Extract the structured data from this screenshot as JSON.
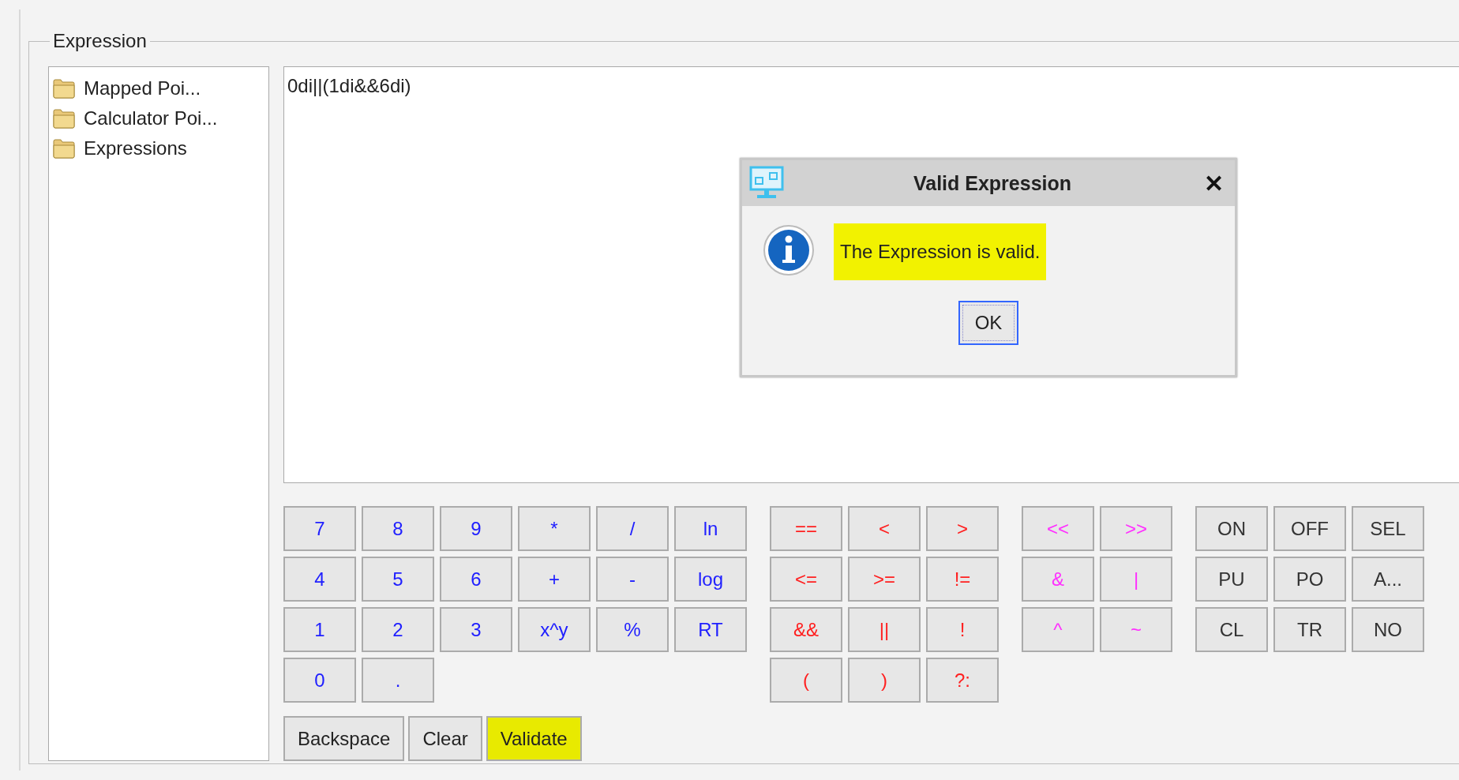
{
  "group": {
    "title": "Expression"
  },
  "tree": {
    "items": [
      {
        "label": "Mapped Poi..."
      },
      {
        "label": "Calculator Poi..."
      },
      {
        "label": "Expressions"
      }
    ]
  },
  "editor": {
    "value": "0di||(1di&&6di)"
  },
  "keypad": {
    "groups": [
      {
        "kind": "number",
        "rows": [
          [
            "7",
            "8",
            "9",
            "*",
            "/",
            "ln"
          ],
          [
            "4",
            "5",
            "6",
            "+",
            "-",
            "log"
          ],
          [
            "1",
            "2",
            "3",
            "x^y",
            "%",
            "RT"
          ],
          [
            "0",
            "."
          ]
        ]
      },
      {
        "kind": "logic",
        "rows": [
          [
            "==",
            "<",
            ">"
          ],
          [
            "<=",
            ">=",
            "!="
          ],
          [
            "&&",
            "||",
            "!"
          ],
          [
            "(",
            ")",
            "?:"
          ]
        ]
      },
      {
        "kind": "bitwise",
        "rows": [
          [
            "<<",
            ">>"
          ],
          [
            "&",
            "|"
          ],
          [
            "^",
            "~"
          ]
        ]
      },
      {
        "kind": "state",
        "rows": [
          [
            "ON",
            "OFF",
            "SEL"
          ],
          [
            "PU",
            "PO",
            "A..."
          ],
          [
            "CL",
            "TR",
            "NO"
          ]
        ]
      }
    ]
  },
  "actions": [
    {
      "label": "Backspace",
      "highlighted": false
    },
    {
      "label": "Clear",
      "highlighted": false
    },
    {
      "label": "Validate",
      "highlighted": true
    }
  ],
  "dialog": {
    "title": "Valid Expression",
    "close": "✕",
    "message": "The Expression is valid.",
    "highlighted": true,
    "button": "OK"
  }
}
